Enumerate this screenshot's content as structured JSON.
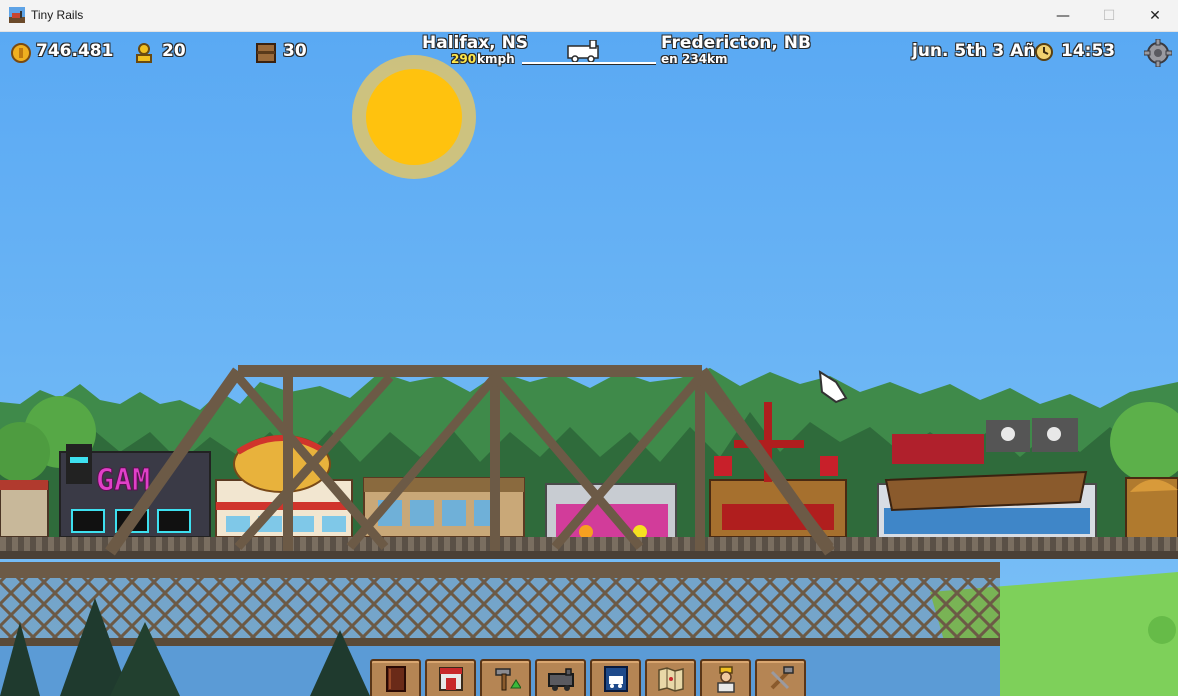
{
  "window": {
    "title": "Tiny Rails",
    "minimize_glyph": "—",
    "maximize_glyph": "☐",
    "close_glyph": "✕"
  },
  "hud": {
    "coins": "746.481",
    "tickets": "20",
    "cargo": "30",
    "origin_city": "Halifax, NS",
    "speed_value": "290",
    "speed_unit": "kmph",
    "destination_city": "Fredericton, NB",
    "distance_prefix": "en",
    "distance_value": "234km",
    "date": "jun. 5th 3 Año",
    "time": "14:53"
  },
  "icons": {
    "coins": "coin-icon",
    "tickets": "passenger-icon",
    "cargo": "crate-icon",
    "train": "train-progress-icon",
    "clock": "clock-icon",
    "settings": "gear-icon"
  },
  "toolbar": [
    {
      "name": "journal-button",
      "icon": "book-icon"
    },
    {
      "name": "shop-button",
      "icon": "shop-icon"
    },
    {
      "name": "build-button",
      "icon": "hammer-upgrade-icon"
    },
    {
      "name": "train-cars-button",
      "icon": "train-car-icon"
    },
    {
      "name": "locomotive-button",
      "icon": "locomotive-card-icon"
    },
    {
      "name": "map-button",
      "icon": "map-icon"
    },
    {
      "name": "crew-button",
      "icon": "worker-icon"
    },
    {
      "name": "tools-button",
      "icon": "tools-icon"
    }
  ],
  "colors": {
    "sky": "#58a7f2",
    "sun": "#ffc20e",
    "bridge": "#6b5a45",
    "trees": "#2f6b3b",
    "grass": "#7ed05a",
    "water": "#5b9bd6",
    "hud_speed": "#ffe84a"
  }
}
